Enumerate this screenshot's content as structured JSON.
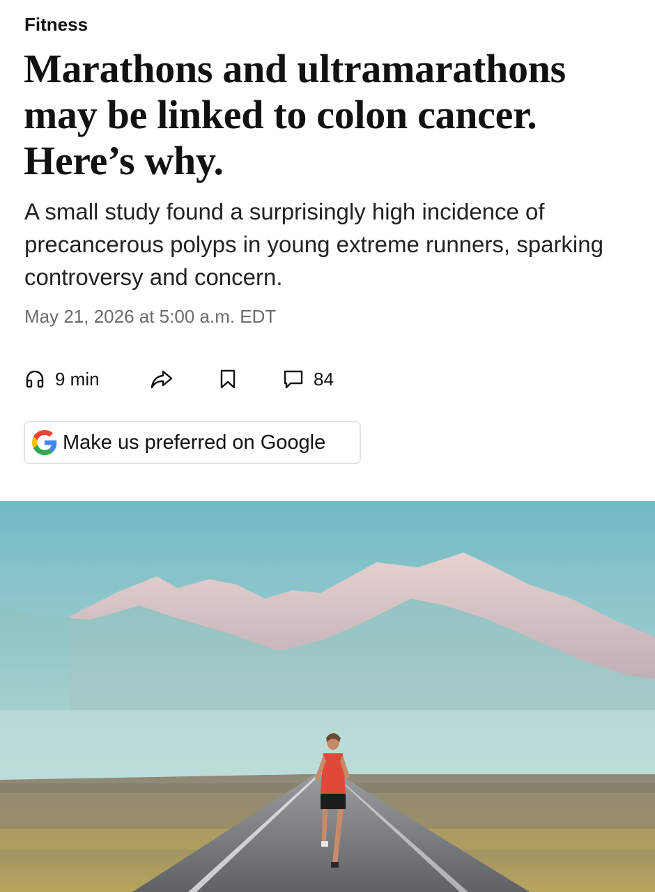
{
  "article": {
    "section": "Fitness",
    "headline": "Marathons and ultramarathons may be linked to colon cancer. Here’s why.",
    "dek": "A small study found a surprisingly high incidence of precancerous polyps in young extreme runners, sparking controversy and concern.",
    "timestamp": "May 21, 2026 at 5:00 a.m. EDT"
  },
  "actions": {
    "listen_label": "9 min",
    "comments_count": "84"
  },
  "google_preferred": {
    "label": "Make us preferred on Google"
  },
  "icons": {
    "listen": "headphones-icon",
    "share": "share-arrow-icon",
    "save": "bookmark-icon",
    "comments": "comment-icon",
    "google": "google-g-logo"
  },
  "colors": {
    "text_primary": "#111111",
    "text_secondary": "#6b6b6b",
    "button_border": "#e2e2e2",
    "google_blue": "#4285F4",
    "google_red": "#EA4335",
    "google_yellow": "#FBBC05",
    "google_green": "#34A853"
  }
}
